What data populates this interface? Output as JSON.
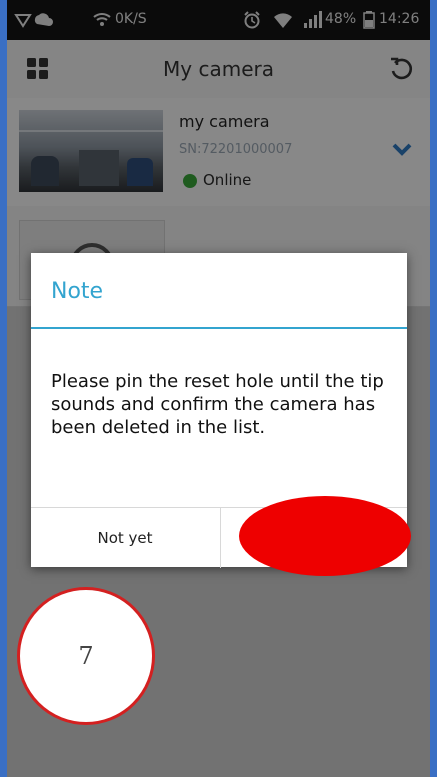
{
  "status_bar": {
    "speed": "0K/S",
    "battery": "48%",
    "time": "14:26"
  },
  "app_bar": {
    "title": "My camera"
  },
  "cameras": [
    {
      "name": "my camera",
      "serial": "SN:72201000007",
      "status": "Online"
    }
  ],
  "dialog": {
    "title": "Note",
    "message": "Please pin the reset hole until the tip sounds and confirm the camera has been deleted in the list.",
    "buttons": {
      "cancel": "Not yet",
      "confirm": ""
    }
  },
  "step_badge": "7",
  "colors": {
    "accent": "#33a4cf",
    "online": "#3aa63a",
    "marker_red": "#ee0000"
  }
}
